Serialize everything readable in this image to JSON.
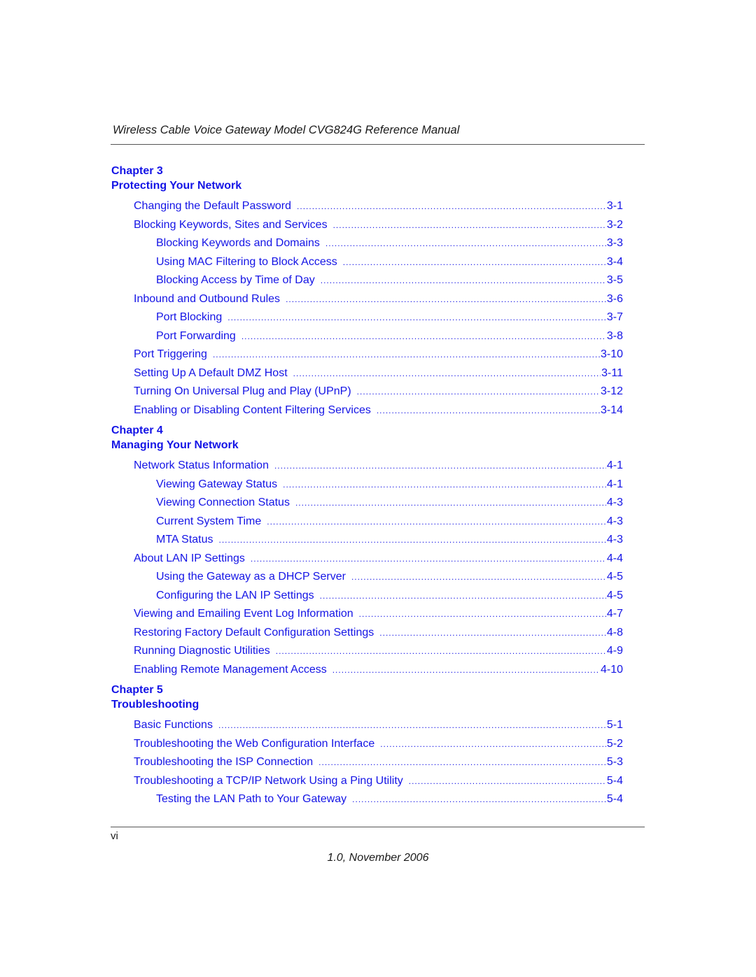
{
  "header": {
    "title": "Wireless Cable Voice Gateway Model CVG824G Reference Manual"
  },
  "chapters": [
    {
      "label": "Chapter 3",
      "title": "Protecting Your Network",
      "entries": [
        {
          "title": "Changing the Default Password",
          "page": "3-1",
          "level": 1
        },
        {
          "title": "Blocking Keywords, Sites and Services",
          "page": "3-2",
          "level": 1
        },
        {
          "title": "Blocking Keywords and Domains",
          "page": "3-3",
          "level": 2
        },
        {
          "title": "Using MAC Filtering to Block Access",
          "page": "3-4",
          "level": 2
        },
        {
          "title": "Blocking Access by Time of Day",
          "page": "3-5",
          "level": 2
        },
        {
          "title": "Inbound and Outbound Rules",
          "page": "3-6",
          "level": 1
        },
        {
          "title": "Port Blocking",
          "page": "3-7",
          "level": 2
        },
        {
          "title": "Port Forwarding",
          "page": "3-8",
          "level": 2
        },
        {
          "title": "Port Triggering",
          "page": "3-10",
          "level": 1
        },
        {
          "title": "Setting Up A Default DMZ Host",
          "page": "3-11",
          "level": 1
        },
        {
          "title": "Turning On Universal Plug and Play (UPnP)",
          "page": "3-12",
          "level": 1
        },
        {
          "title": "Enabling or Disabling Content Filtering Services",
          "page": "3-14",
          "level": 1
        }
      ]
    },
    {
      "label": "Chapter 4",
      "title": "Managing Your Network",
      "entries": [
        {
          "title": "Network Status Information",
          "page": "4-1",
          "level": 1
        },
        {
          "title": "Viewing Gateway Status",
          "page": "4-1",
          "level": 2
        },
        {
          "title": "Viewing Connection Status",
          "page": "4-3",
          "level": 2
        },
        {
          "title": "Current System Time",
          "page": "4-3",
          "level": 2
        },
        {
          "title": "MTA Status",
          "page": "4-3",
          "level": 2
        },
        {
          "title": "About LAN IP Settings",
          "page": "4-4",
          "level": 1
        },
        {
          "title": "Using the Gateway as a DHCP Server",
          "page": "4-5",
          "level": 2
        },
        {
          "title": "Configuring the LAN IP Settings",
          "page": "4-5",
          "level": 2
        },
        {
          "title": "Viewing and Emailing Event Log Information",
          "page": "4-7",
          "level": 1
        },
        {
          "title": "Restoring Factory Default Configuration Settings",
          "page": "4-8",
          "level": 1
        },
        {
          "title": "Running Diagnostic Utilities",
          "page": "4-9",
          "level": 1
        },
        {
          "title": "Enabling Remote Management Access",
          "page": "4-10",
          "level": 1
        }
      ]
    },
    {
      "label": "Chapter 5",
      "title": "Troubleshooting",
      "entries": [
        {
          "title": "Basic Functions",
          "page": "5-1",
          "level": 1
        },
        {
          "title": "Troubleshooting the Web Configuration Interface",
          "page": "5-2",
          "level": 1
        },
        {
          "title": "Troubleshooting the ISP Connection",
          "page": "5-3",
          "level": 1
        },
        {
          "title": "Troubleshooting a TCP/IP Network Using a Ping Utility",
          "page": "5-4",
          "level": 1
        },
        {
          "title": "Testing the LAN Path to Your Gateway",
          "page": "5-4",
          "level": 2
        }
      ]
    }
  ],
  "footer": {
    "page_number": "vi",
    "version": "1.0, November 2006"
  },
  "colors": {
    "link": "#1414e6",
    "text": "#1a1a1a"
  }
}
